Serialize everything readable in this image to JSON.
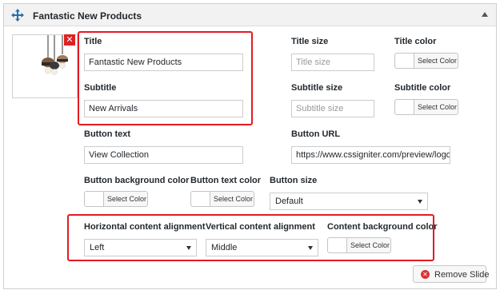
{
  "panel": {
    "title": "Fantastic New Products"
  },
  "fields": {
    "title_label": "Title",
    "title_value": "Fantastic New Products",
    "subtitle_label": "Subtitle",
    "subtitle_value": "New Arrivals",
    "title_size_label": "Title size",
    "title_size_placeholder": "Title size",
    "title_color_label": "Title color",
    "subtitle_size_label": "Subtitle size",
    "subtitle_size_placeholder": "Subtitle size",
    "subtitle_color_label": "Subtitle color",
    "button_text_label": "Button text",
    "button_text_value": "View Collection",
    "button_url_label": "Button URL",
    "button_url_value": "https://www.cssigniter.com/preview/logo",
    "button_bg_color_label": "Button background color",
    "button_text_color_label": "Button text color",
    "button_size_label": "Button size",
    "button_size_value": "Default",
    "h_align_label": "Horizontal content alignment",
    "h_align_value": "Left",
    "v_align_label": "Vertical content alignment",
    "v_align_value": "Middle",
    "content_bg_label": "Content background color"
  },
  "color_picker": {
    "label": "Select Color"
  },
  "actions": {
    "remove_slide": "Remove Slide"
  },
  "colors": {
    "highlight": "#e31b23",
    "remove": "#dc3232",
    "move_icon": "#2271b1"
  },
  "icons": {
    "move": "move-icon",
    "collapse": "triangle-up-icon",
    "remove_image": "close-icon",
    "remove_slide": "circle-x-icon"
  }
}
